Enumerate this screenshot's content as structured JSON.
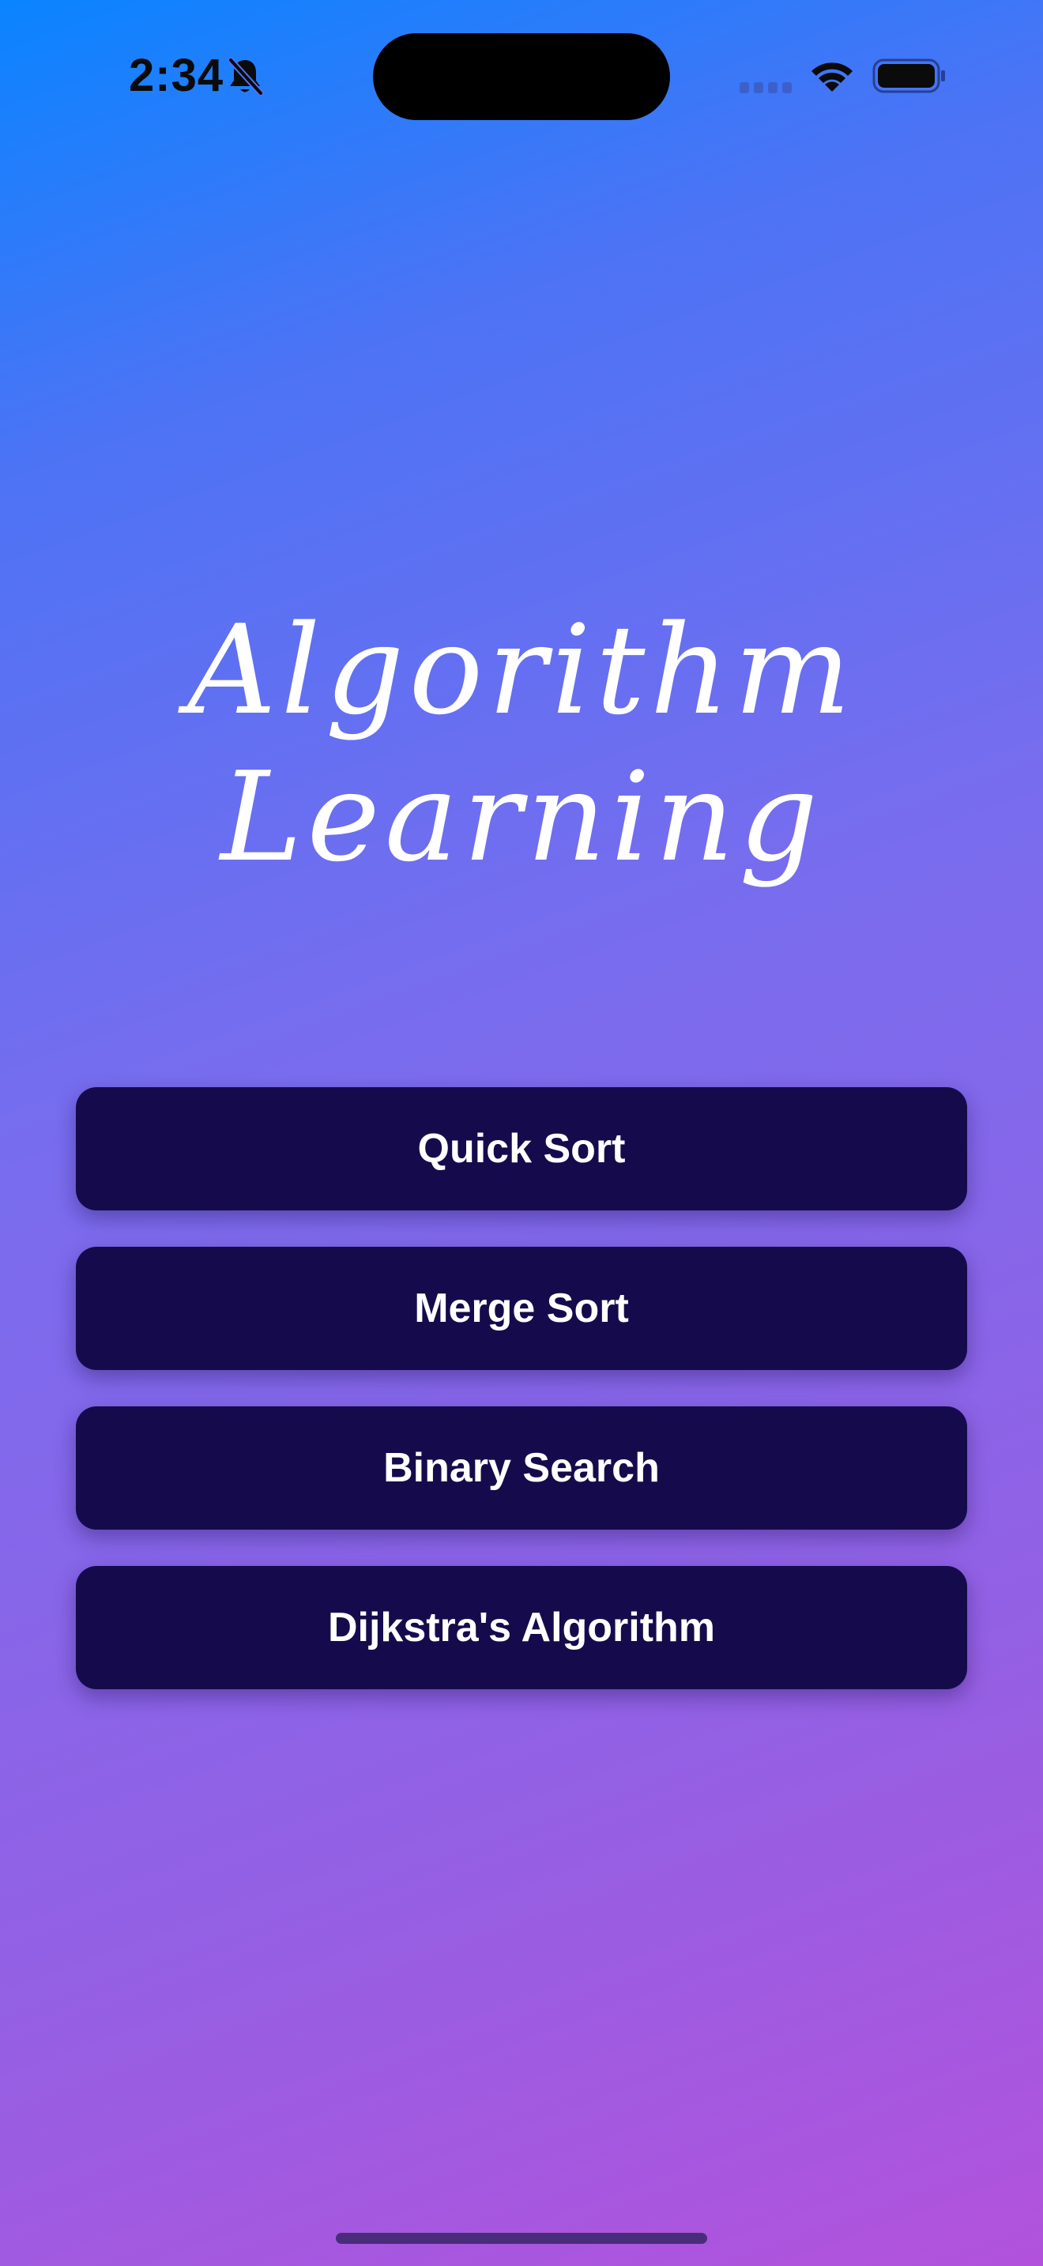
{
  "status_bar": {
    "time": "2:34",
    "icons": [
      "bell-slash-icon",
      "signal-icon",
      "wifi-icon",
      "battery-icon"
    ]
  },
  "title": {
    "line1": "Algorithm",
    "line2": "Learning"
  },
  "menu": {
    "items": [
      {
        "label": "Quick Sort"
      },
      {
        "label": "Merge Sort"
      },
      {
        "label": "Binary Search"
      },
      {
        "label": "Dijkstra's Algorithm"
      }
    ]
  },
  "colors": {
    "gradient_top": "#0a84ff",
    "gradient_bottom": "#b252dc",
    "button_background": "#150b4c",
    "button_text": "#ffffff",
    "title_text": "#ffffff"
  }
}
